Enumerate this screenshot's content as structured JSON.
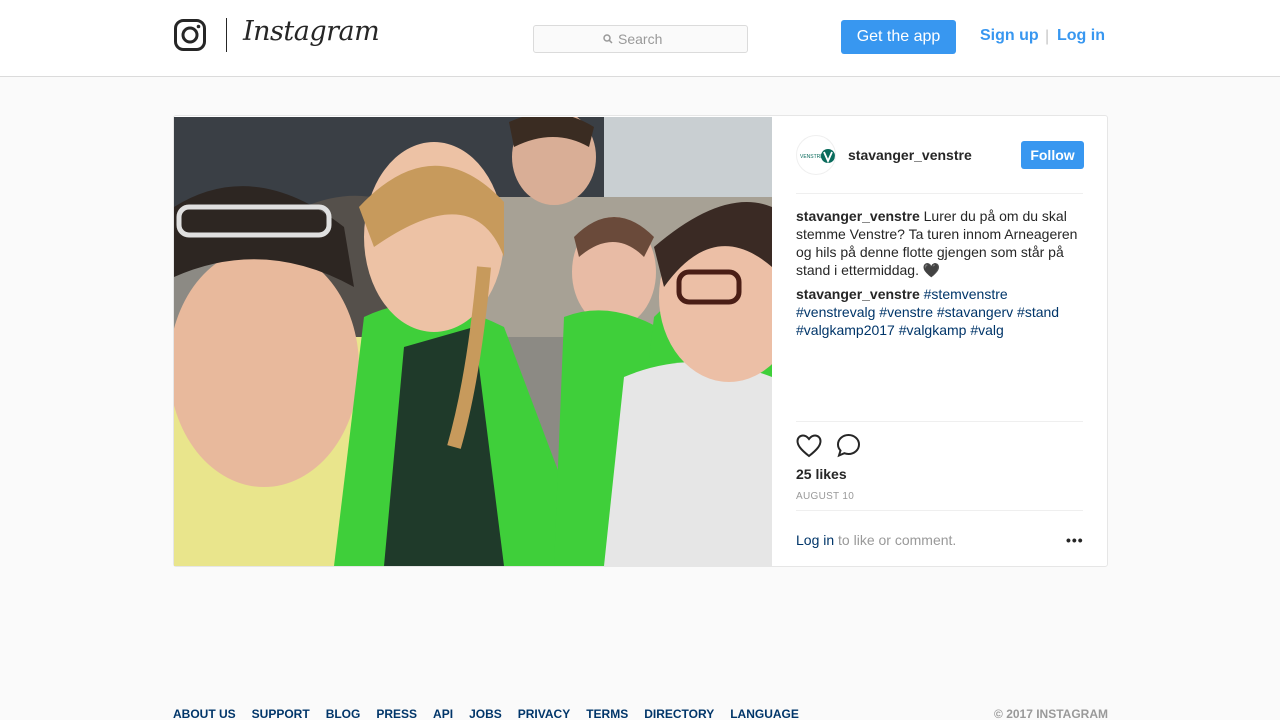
{
  "header": {
    "logo_text": "Instagram",
    "search_placeholder": "Search",
    "get_app_label": "Get the app",
    "signup_label": "Sign up",
    "separator": "|",
    "login_label": "Log in"
  },
  "post": {
    "username": "stavanger_venstre",
    "follow_label": "Follow",
    "caption_user": "stavanger_venstre",
    "caption_text": "Lurer du på om du skal stemme Venstre? Ta turen innom Arneageren og hils på denne flotte gjengen som står på stand i ettermiddag. 🖤",
    "comment_user": "stavanger_venstre",
    "hashtags": [
      "#stemvenstre",
      "#venstrevalg",
      "#venstre",
      "#stavangerv",
      "#stand",
      "#valgkamp2017",
      "#valgkamp",
      "#valg"
    ],
    "likes": "25 likes",
    "date": "AUGUST 10",
    "login_link": "Log in",
    "login_suffix": " to like or comment.",
    "more_label": "•••",
    "avatar_text": "VENSTRE"
  },
  "footer": {
    "links": [
      "ABOUT US",
      "SUPPORT",
      "BLOG",
      "PRESS",
      "API",
      "JOBS",
      "PRIVACY",
      "TERMS",
      "DIRECTORY",
      "LANGUAGE"
    ],
    "copyright": "© 2017 INSTAGRAM"
  },
  "colors": {
    "accent": "#3897f0",
    "link": "#003569",
    "jacket_green": "#3fcf3a"
  }
}
